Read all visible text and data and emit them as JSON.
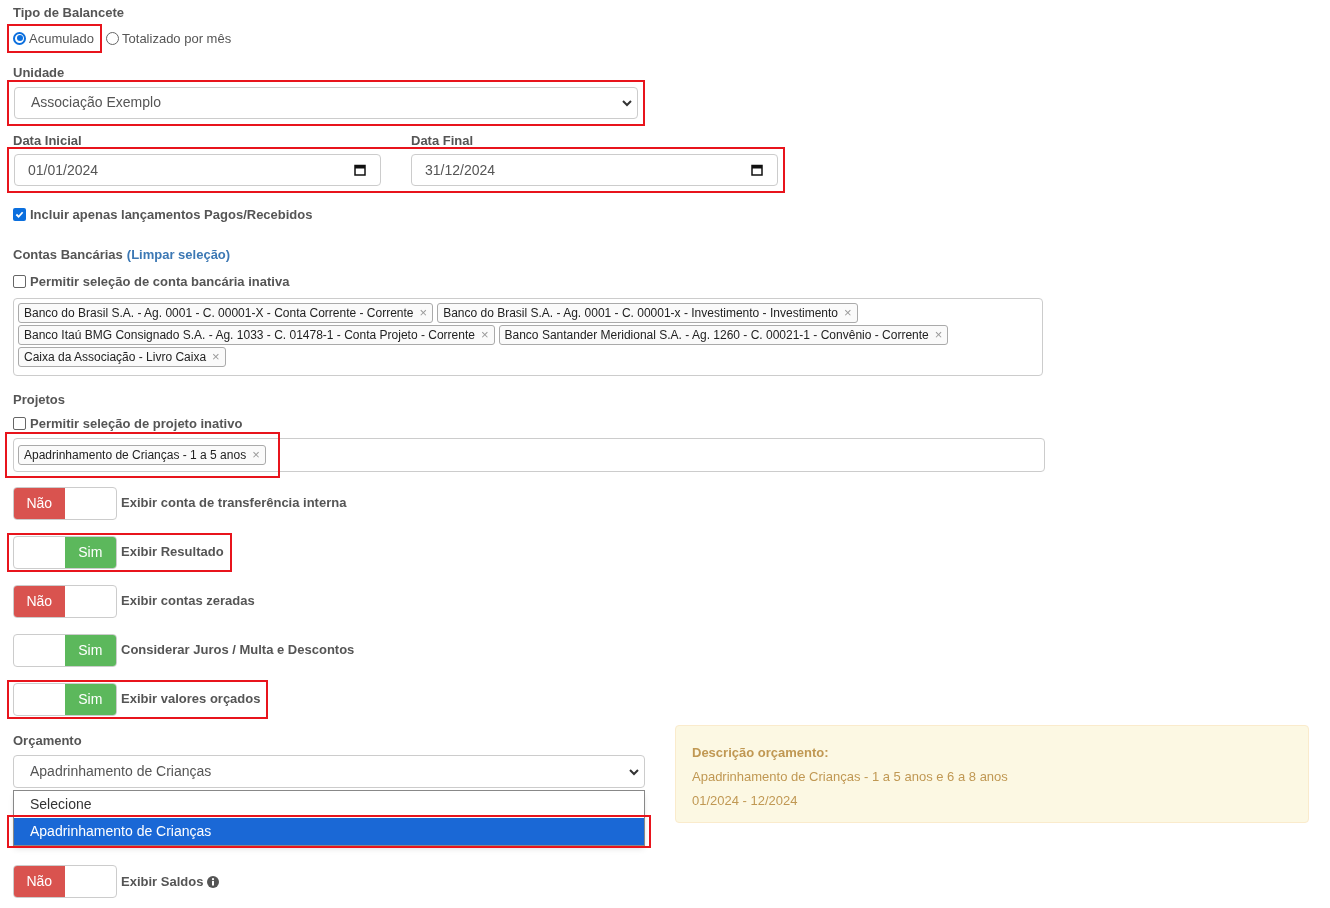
{
  "balance_type": {
    "label": "Tipo de Balancete",
    "options": [
      {
        "label": "Acumulado",
        "selected": true,
        "highlighted": true
      },
      {
        "label": "Totalizado por mês",
        "selected": false,
        "highlighted": false
      }
    ]
  },
  "unit": {
    "label": "Unidade",
    "value": "Associação Exemplo",
    "highlighted": true
  },
  "dates": {
    "highlighted": true,
    "fields": [
      {
        "label": "Data Inicial",
        "value": "01/01/2024"
      },
      {
        "label": "Data Final",
        "value": "31/12/2024"
      }
    ]
  },
  "paid_only": {
    "label": "Incluir apenas lançamentos Pagos/Recebidos",
    "checked": true
  },
  "bank_accounts": {
    "label": "Contas Bancárias",
    "link": "(Limpar seleção)",
    "inactive": {
      "label": "Permitir seleção de conta bancária inativa",
      "checked": false
    },
    "highlighted": false,
    "tags": [
      {
        "label": "Banco do Brasil S.A. - Ag. 0001 - C. 00001-X - Conta Corrente - Corrente",
        "remove": "×"
      },
      {
        "label": "Banco do Brasil S.A. - Ag. 0001 - C. 00001-x - Investimento - Investimento",
        "remove": "×"
      },
      {
        "label": "Banco Itaú BMG Consignado S.A. - Ag. 1033 - C. 01478-1 - Conta Projeto - Corrente",
        "remove": "×"
      },
      {
        "label": "Banco Santander Meridional S.A. - Ag. 1260 - C. 00021-1 - Convênio - Corrente",
        "remove": "×"
      },
      {
        "label": "Caixa da Associação - Livro Caixa",
        "remove": "×"
      }
    ]
  },
  "projects": {
    "label": "Projetos",
    "inactive": {
      "label": "Permitir seleção de projeto inativo",
      "checked": false
    },
    "highlighted": true,
    "tags": [
      {
        "label": "Apadrinhamento de Crianças - 1 a 5 anos",
        "remove": "×"
      }
    ]
  },
  "toggles": [
    {
      "label": "Exibir conta de transferência interna",
      "on": false,
      "text": "Não",
      "highlighted": false
    },
    {
      "label": "Exibir Resultado",
      "on": true,
      "text": "Sim",
      "highlighted": true
    },
    {
      "label": "Exibir contas zeradas",
      "on": false,
      "text": "Não",
      "highlighted": false
    },
    {
      "label": "Considerar Juros / Multa e Descontos",
      "on": true,
      "text": "Sim",
      "highlighted": false
    },
    {
      "label": "Exibir valores orçados",
      "on": true,
      "text": "Sim",
      "highlighted": true
    }
  ],
  "budget": {
    "label": "Orçamento",
    "value": "Apadrinhamento de Crianças",
    "options": [
      {
        "label": "Selecione",
        "selected": false,
        "highlighted": false
      },
      {
        "label": "Apadrinhamento de Crianças",
        "selected": true,
        "highlighted": true
      }
    ]
  },
  "budget_info": {
    "title": "Descrição orçamento:",
    "lines": [
      "Apadrinhamento de Crianças - 1 a 5 anos e 6 a 8 anos",
      "01/2024 - 12/2024"
    ]
  },
  "last_toggle": {
    "label": "Exibir Saldos",
    "on": false,
    "text": "Não",
    "highlighted": false
  }
}
